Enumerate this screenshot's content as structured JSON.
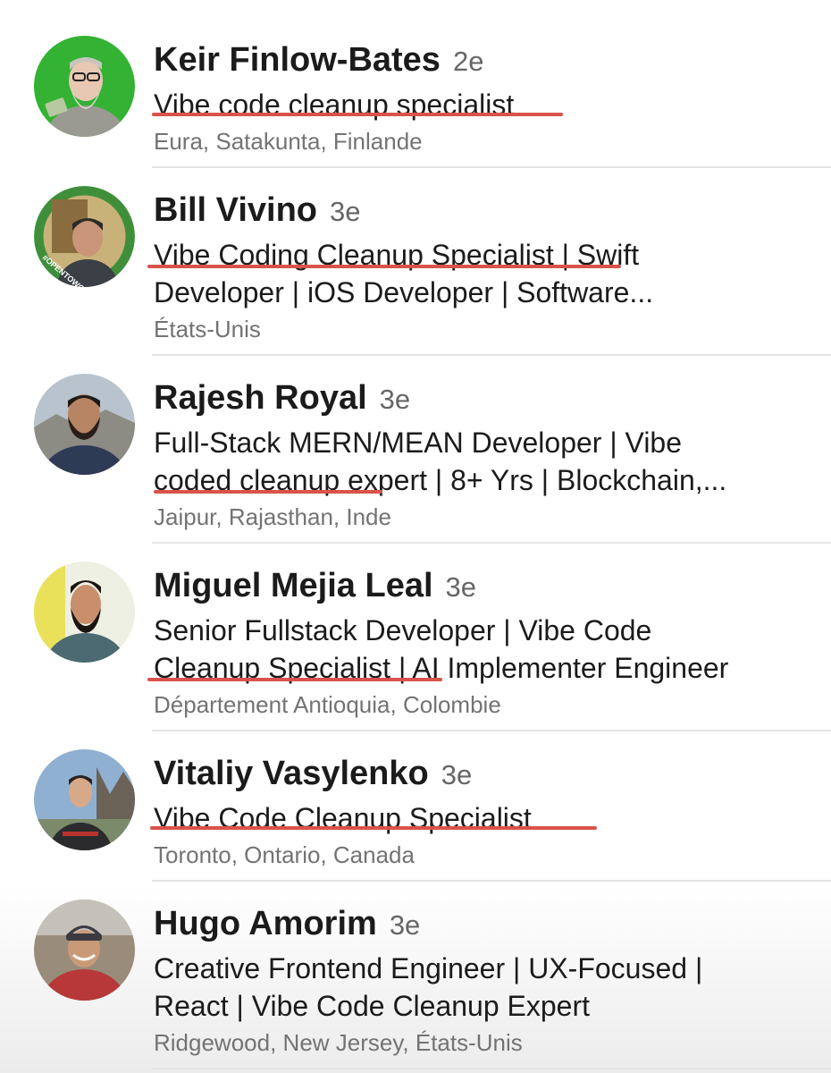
{
  "results": [
    {
      "name": "Keir Finlow-Bates",
      "degree": "2e",
      "headline_lines": [
        "Vibe code cleanup specialist"
      ],
      "location": "Eura, Satakunta, Finlande",
      "avatar_icon": "person-avatar-green-bg"
    },
    {
      "name": "Bill Vivino",
      "degree": "3e",
      "headline_lines": [
        "Vibe Coding Cleanup Specialist | Swift",
        "Developer | iOS Developer | Software..."
      ],
      "location": "États-Unis",
      "avatar_icon": "person-avatar-opentowork",
      "avatar_badge": "#OPENTOWORK"
    },
    {
      "name": "Rajesh Royal",
      "degree": "3e",
      "headline_lines": [
        "Full-Stack MERN/MEAN Developer | Vibe",
        "coded cleanup expert | 8+ Yrs | Blockchain,..."
      ],
      "location": "Jaipur, Rajasthan, Inde",
      "avatar_icon": "person-avatar"
    },
    {
      "name": "Miguel Mejia Leal",
      "degree": "3e",
      "headline_lines": [
        "Senior Fullstack Developer | Vibe Code",
        "Cleanup Specialist | AI Implementer Engineer"
      ],
      "location": "Département Antioquia, Colombie",
      "avatar_icon": "person-avatar"
    },
    {
      "name": "Vitaliy Vasylenko",
      "degree": "3e",
      "headline_lines": [
        "Vibe Code Cleanup Specialist"
      ],
      "location": "Toronto, Ontario, Canada",
      "avatar_icon": "person-avatar"
    },
    {
      "name": "Hugo Amorim",
      "degree": "3e",
      "headline_lines": [
        "Creative Frontend Engineer | UX-Focused |",
        "React | Vibe Code Cleanup Expert"
      ],
      "location": "Ridgewood, New Jersey, États-Unis",
      "avatar_icon": "person-avatar"
    }
  ],
  "colors": {
    "underline": "#d9534a",
    "opentowork_ring": "#3f8f3a",
    "text_primary": "#1b1b1b",
    "text_secondary": "#737373"
  }
}
